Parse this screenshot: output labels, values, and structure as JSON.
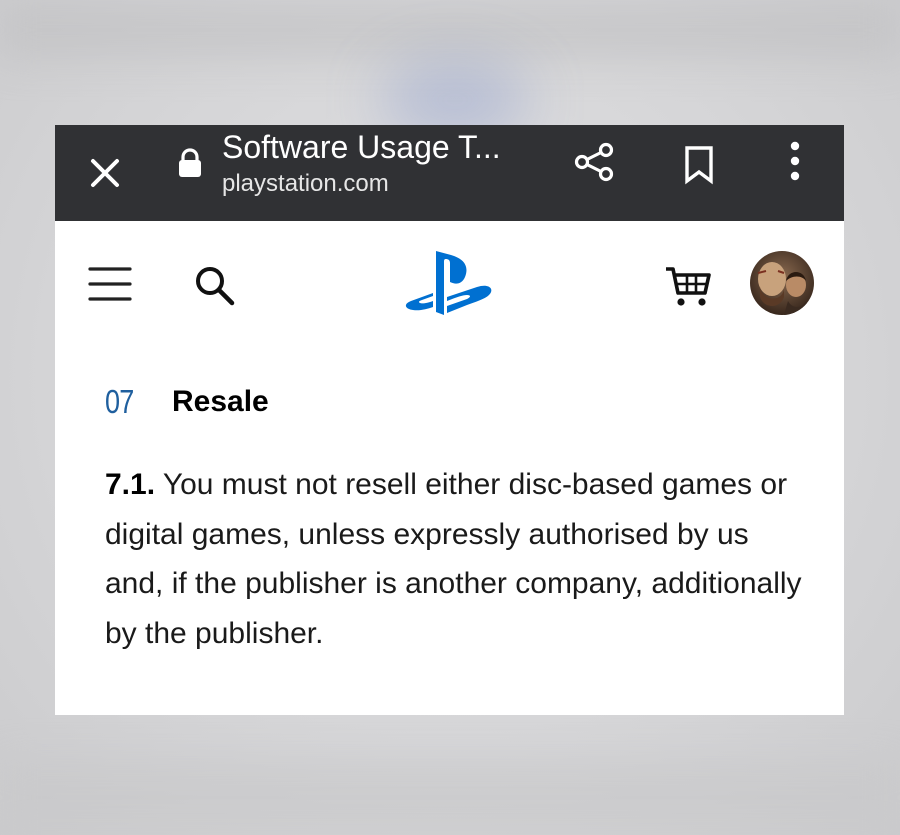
{
  "browser": {
    "page_title": "Software Usage T...",
    "url": "playstation.com",
    "icons": {
      "close": "close-icon",
      "lock": "lock-icon",
      "share": "share-icon",
      "bookmark": "bookmark-icon",
      "menu": "more-vert-icon"
    }
  },
  "site_header": {
    "icons": {
      "menu": "hamburger-icon",
      "search": "search-icon",
      "logo": "playstation-logo",
      "cart": "cart-icon",
      "avatar": "avatar"
    }
  },
  "content": {
    "section_number": "07",
    "section_title": "Resale",
    "clause_number": "7.1.",
    "clause_text": "You must not resell either disc-based games or digital games, unless expressly authorised by us and, if the publisher is another company, additionally by the publisher."
  },
  "colors": {
    "browser_bar": "#303134",
    "playstation_blue": "#0070d1",
    "section_number": "#1f5f9e",
    "text": "#1a1a1a"
  }
}
